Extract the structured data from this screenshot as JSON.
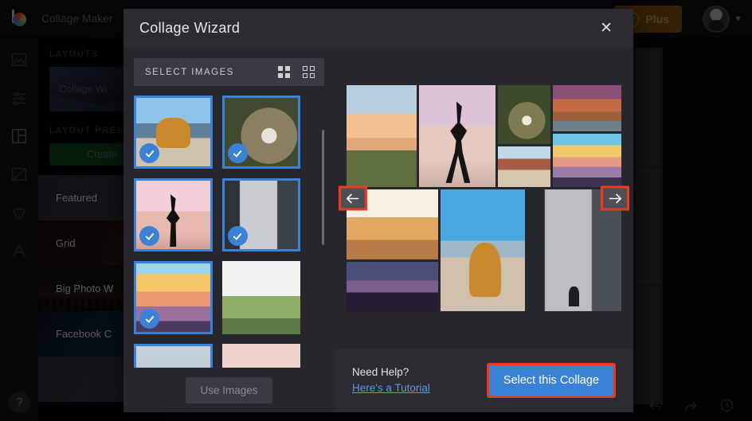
{
  "topbar": {
    "app_title": "Collage Maker",
    "plus_label": "Plus",
    "plus_icon": "star-icon",
    "avatar_icon": "avatar",
    "chevron_icon": "chevron-down-icon",
    "logo_icon": "brand-logo-icon"
  },
  "left_rail": {
    "items": [
      {
        "icon": "photo-icon",
        "name": "photos"
      },
      {
        "icon": "sliders-icon",
        "name": "adjust"
      },
      {
        "icon": "collage-grid-icon",
        "name": "collage",
        "active": true
      },
      {
        "icon": "effects-icon",
        "name": "effects"
      },
      {
        "icon": "heart-icon",
        "name": "favorites"
      },
      {
        "icon": "text-a-icon",
        "name": "text"
      }
    ],
    "help_label": "?"
  },
  "side_panel": {
    "layouts_heading": "LAYOUTS",
    "wizard_card_label": "Collage Wi",
    "presets_heading": "LAYOUT PRES",
    "create_button_label": "Create",
    "presets": [
      {
        "label": "Featured",
        "class": "pi-featured"
      },
      {
        "label": "Grid",
        "class": "pi-grid"
      },
      {
        "label": "Big Photo W",
        "class": "pi-big"
      },
      {
        "label": "Facebook C",
        "class": "pi-fb"
      },
      {
        "label": "",
        "class": "pi-last"
      }
    ]
  },
  "bottom_toolbar": {
    "icons": [
      "flip-icon",
      "undo-icon",
      "redo-icon",
      "history-clock-icon"
    ]
  },
  "modal": {
    "title": "Collage Wizard",
    "close_icon": "close-icon",
    "select_images": {
      "header": "SELECT IMAGES",
      "view_large_icon": "grid-large-icon",
      "view_small_icon": "grid-small-icon",
      "use_images_label": "Use Images",
      "thumbnails": [
        {
          "name": "woman-sitting-mountain",
          "style": "p-hiker",
          "selected": true
        },
        {
          "name": "pouring-coffee-mug",
          "style": "p-coffee",
          "selected": true
        },
        {
          "name": "hiker-silhouette-pink-sky",
          "style": "p-silhou",
          "selected": true
        },
        {
          "name": "waterfall-cliff",
          "style": "p-falls",
          "selected": true
        },
        {
          "name": "sunset-mountain-layers",
          "style": "p-sunset",
          "selected": true
        },
        {
          "name": "friends-arms-raised",
          "style": "p-friends",
          "selected": false
        },
        {
          "name": "pale-sky",
          "style": "p-pale",
          "selected": true
        },
        {
          "name": "pink-clouds",
          "style": "p-pinkcld",
          "selected": false
        }
      ]
    },
    "preview": {
      "prev_icon": "arrow-left-icon",
      "next_icon": "arrow-right-icon",
      "collage_cells": [
        {
          "name": "cactus-sunset",
          "style": "p-cactus"
        },
        {
          "name": "tripod-silhouette",
          "style": "p-tripod"
        },
        {
          "name": "coffee-mug-forest",
          "style": "p-mug"
        },
        {
          "name": "van-desert-road",
          "style": "p-vanroad"
        },
        {
          "name": "red-rock-canyon",
          "style": "p-canyon"
        },
        {
          "name": "sunset-mountain-vista",
          "style": "p-vista"
        },
        {
          "name": "people-running-desert",
          "style": "p-run"
        },
        {
          "name": "joshua-tree-night-sky",
          "style": "p-night"
        },
        {
          "name": "woman-sitting-mountain-large",
          "style": "p-sitmtn"
        },
        {
          "name": "waterfall-person-large",
          "style": "p-fallsbig"
        }
      ]
    },
    "footer": {
      "need_help": "Need Help?",
      "tutorial_link": "Here's a Tutorial",
      "select_collage_label": "Select this Collage"
    }
  },
  "colors": {
    "accent_blue": "#3b82d6",
    "highlight_red": "#f0391a",
    "modal_bg": "#26262c",
    "plus_gold": "#c9a36a",
    "create_green": "#11471f"
  }
}
